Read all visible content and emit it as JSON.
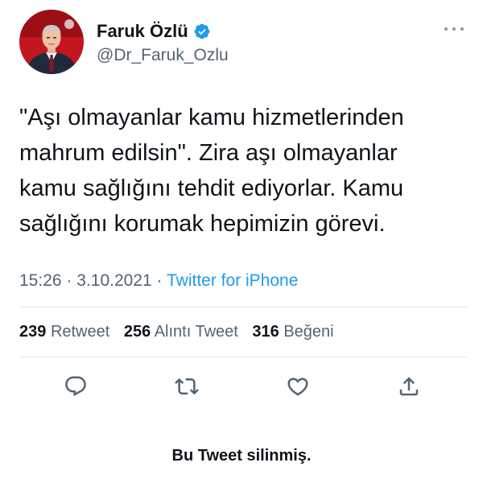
{
  "author": {
    "display_name": "Faruk Özlü",
    "handle": "@Dr_Faruk_Ozlu",
    "verified": true
  },
  "tweet": {
    "text": "\"Aşı olmayanlar kamu hizmetlerinden\nmahrum edilsin\". Zira aşı olmayanlar\nkamu sağlığını tehdit ediyorlar. Kamu\nsağlığını korumak hepimizin görevi.",
    "time": "15:26",
    "date": "3.10.2021",
    "separator": "·",
    "source": "Twitter for iPhone"
  },
  "stats": {
    "retweets_count": "239",
    "retweets_label": "Retweet",
    "quotes_count": "256",
    "quotes_label": "Alıntı Tweet",
    "likes_count": "316",
    "likes_label": "Beğeni"
  },
  "actions": [
    {
      "icon": "reply-icon"
    },
    {
      "icon": "retweet-icon"
    },
    {
      "icon": "like-icon"
    },
    {
      "icon": "share-icon"
    }
  ],
  "notice": "Bu Tweet silinmiş.",
  "colors": {
    "text": "#0f1419",
    "secondary": "#536471",
    "link": "#1d9bf0",
    "verified": "#1d9bf0",
    "divider": "#e3e8ec"
  }
}
